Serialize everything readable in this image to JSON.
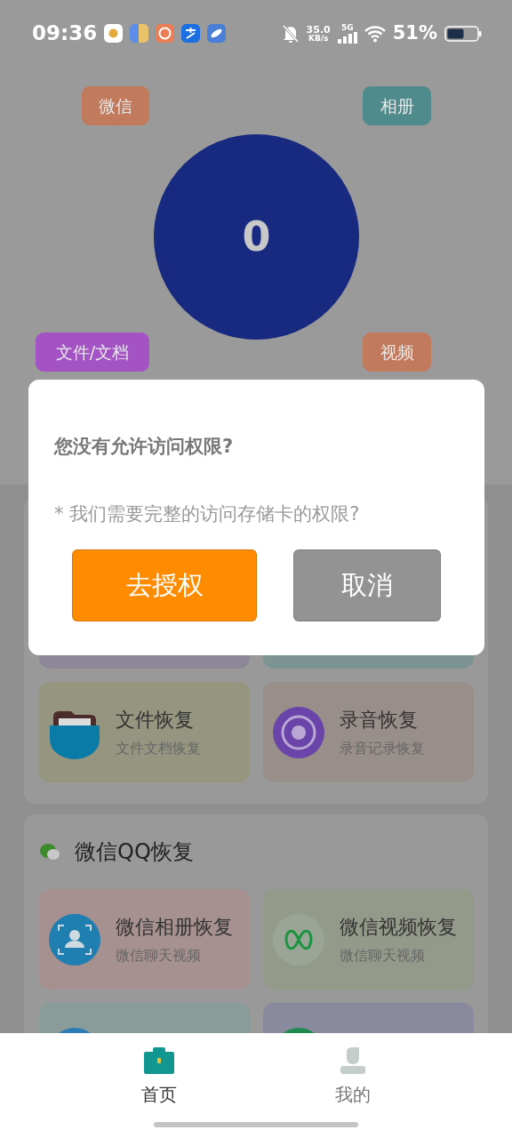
{
  "status_bar": {
    "time": "09:36",
    "speed": "35.0",
    "speed_unit": "KB/s",
    "network": "5G",
    "battery": "51%"
  },
  "shortcuts": [
    {
      "label": "微信",
      "color": "#c27a5c"
    },
    {
      "label": "相册",
      "color": "#4f8b8c"
    },
    {
      "label": "文件/文档",
      "color": "#a453c4"
    },
    {
      "label": "视频",
      "color": "#c27a5c"
    }
  ],
  "counter": "0",
  "sections": [
    {
      "cards": [
        {
          "color": "#8d8798"
        },
        {
          "color": "#7d9592"
        },
        {
          "title": "文件恢复",
          "subtitle": "文件文档恢复",
          "color": "#959580"
        },
        {
          "title": "录音恢复",
          "subtitle": "录音记录恢复",
          "color": "#988f8b"
        }
      ]
    },
    {
      "title": "微信QQ恢复",
      "cards": [
        {
          "title": "微信相册恢复",
          "subtitle": "微信聊天视频",
          "color": "#a69090"
        },
        {
          "title": "微信视频恢复",
          "subtitle": "微信聊天视频",
          "color": "#949a8a"
        },
        {
          "color": "#8a9c99"
        },
        {
          "color": "#8a8a9f"
        }
      ]
    }
  ],
  "dialog": {
    "title": "您没有允许访问权限?",
    "message": "* 我们需要完整的访问存储卡的权限?",
    "buttons": [
      {
        "label": "去授权",
        "kind": "primary"
      },
      {
        "label": "取消",
        "kind": "secondary"
      }
    ]
  },
  "tabs": [
    {
      "label": "首页",
      "selected": true
    },
    {
      "label": "我的",
      "selected": false
    }
  ]
}
